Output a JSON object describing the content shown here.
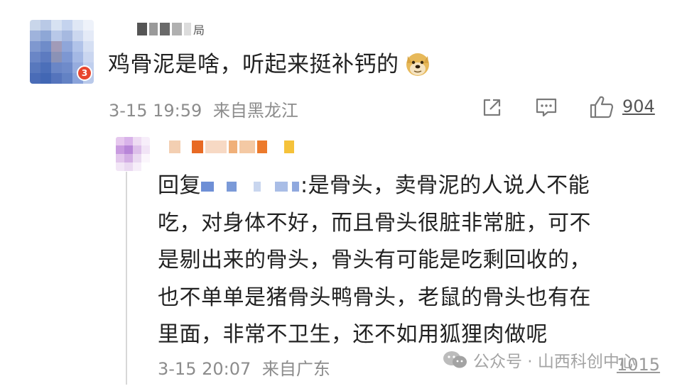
{
  "comment": {
    "text": "鸡骨泥是啥，听起来挺补钙的",
    "emoji": "doge-emoji",
    "badge": "3",
    "date": "3-15 19:59",
    "location": "来自黑龙江",
    "likes": "904",
    "username_visible": "局"
  },
  "reply": {
    "prefix": "回复",
    "lines": [
      ":是骨头，卖骨泥的人说人不能",
      "吃，对身体不好，而且骨头很脏非常脏，可不",
      "是剔出来的骨头，骨头有可能是吃剩回收的，",
      "也不单单是猪骨头鸭骨头，老鼠的骨头也有在",
      "里面，非常不卫生，还不如用狐狸肉做呢"
    ],
    "date": "3-15 20:07",
    "location": "来自广东",
    "likes": "1015"
  },
  "watermark": {
    "text": "公众号 · 山西科创中心"
  },
  "icons": [
    "share-icon",
    "comment-icon",
    "like-icon",
    "wechat-icon"
  ],
  "colors": {
    "text_primary": "#222222",
    "text_meta": "#8c8c8c",
    "badge": "#e8462e",
    "divider": "#d8d8d8"
  }
}
